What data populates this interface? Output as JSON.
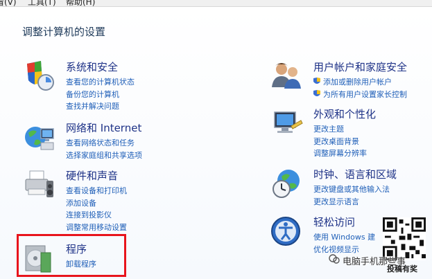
{
  "menubar": {
    "view": "看(V)",
    "tools": "工具(T)",
    "help": "帮助(H)"
  },
  "heading": "调整计算机的设置",
  "categories": [
    {
      "title": "系统和安全",
      "links": [
        "查看您的计算机状态",
        "备份您的计算机",
        "查找并解决问题"
      ]
    },
    {
      "title": "网络和 Internet",
      "links": [
        "查看网络状态和任务",
        "选择家庭组和共享选项"
      ]
    },
    {
      "title": "硬件和声音",
      "links": [
        "查看设备和打印机",
        "添加设备",
        "连接到投影仪",
        "调整常用移动设置"
      ]
    },
    {
      "title": "程序",
      "links": [
        "卸载程序"
      ]
    },
    {
      "title": "用户帐户和家庭安全",
      "links": [
        "添加或删除用户帐户",
        "为所有用户设置家长控制"
      ]
    },
    {
      "title": "外观和个性化",
      "links": [
        "更改主题",
        "更改桌面背景",
        "调整屏幕分辨率"
      ]
    },
    {
      "title": "时钟、语言和区域",
      "links": [
        "更改键盘或其他输入法",
        "更改显示语言"
      ]
    },
    {
      "title": "轻松访问",
      "links": [
        "使用 Windows 建",
        "优化视频显示"
      ]
    }
  ],
  "watermark": {
    "text": "电脑手机那些事",
    "sub": "投稿有奖"
  },
  "colors": {
    "title": "#1e3287",
    "link": "#1f5fb8",
    "highlight_box": "#e8141c"
  }
}
